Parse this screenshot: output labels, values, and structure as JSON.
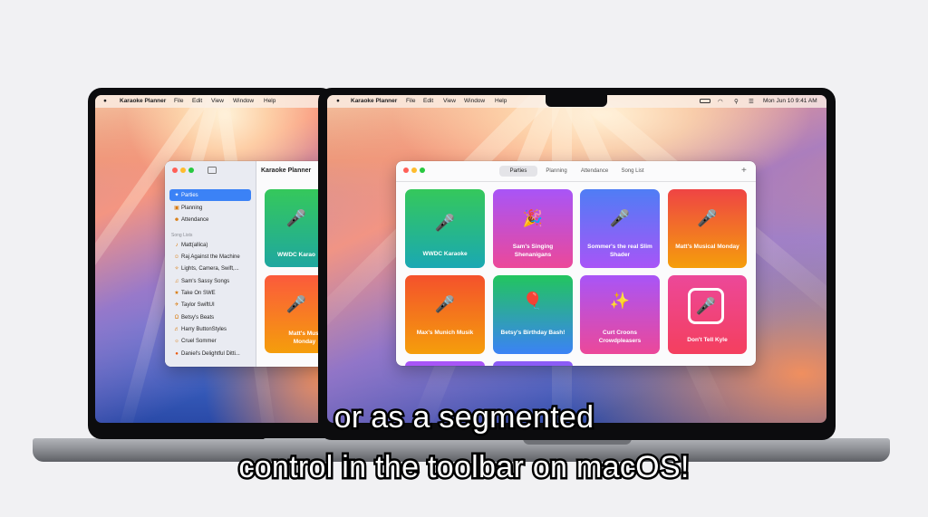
{
  "menubar": {
    "app_name": "Karaoke Planner",
    "items": [
      "File",
      "Edit",
      "View",
      "Window",
      "Help"
    ],
    "clock": "Mon Jun 10  9:41 AM"
  },
  "left_window": {
    "toolbar_title": "Karaoke Planner",
    "sidebar_items": [
      {
        "label": "Parties",
        "icon": "party-popper-icon",
        "selected": true
      },
      {
        "label": "Planning",
        "icon": "calendar-icon",
        "selected": false
      },
      {
        "label": "Attendance",
        "icon": "people-icon",
        "selected": false
      }
    ],
    "section_header": "Song Lists",
    "song_lists": [
      {
        "label": "Matt(allica)",
        "icon": "music-note-icon"
      },
      {
        "label": "Raj Against the Machine",
        "icon": "smiley-icon"
      },
      {
        "label": "Lights, Camera, Swift,...",
        "icon": "sparkle-icon"
      },
      {
        "label": "Sam's Sassy Songs",
        "icon": "music-notes-icon"
      },
      {
        "label": "Take On SWE",
        "icon": "star-icon"
      },
      {
        "label": "Taylor SwiftUI",
        "icon": "bird-icon"
      },
      {
        "label": "Betsy's Beats",
        "icon": "headphones-icon"
      },
      {
        "label": "Harry ButtonStyles",
        "icon": "guitar-icon"
      },
      {
        "label": "Cruel Sommer",
        "icon": "sun-icon"
      },
      {
        "label": "Daniel's Delightful Ditti...",
        "icon": "circle-icon"
      }
    ],
    "tiles": [
      {
        "title": "WWDC Karao",
        "icon": "microphone-icon"
      },
      {
        "title": "Matt's Musi Monday",
        "icon": "microphone-circle-icon"
      }
    ]
  },
  "right_window": {
    "segments": [
      {
        "label": "Parties",
        "selected": true
      },
      {
        "label": "Planning",
        "selected": false
      },
      {
        "label": "Attendance",
        "selected": false
      },
      {
        "label": "Song List",
        "selected": false
      }
    ],
    "add_label": "+",
    "tiles": [
      {
        "title": "WWDC Karaoke",
        "icon": "microphone-icon"
      },
      {
        "title": "Sam's Singing Shenanigans",
        "icon": "party-popper-icon"
      },
      {
        "title": "Sommer's the real Slim Shader",
        "icon": "microphone-tilted-icon"
      },
      {
        "title": "Matt's Musical Monday",
        "icon": "microphone-circle-icon"
      },
      {
        "title": "Max's Munich Musik",
        "icon": "microphone-slash-icon"
      },
      {
        "title": "Betsy's Birthday Bash!",
        "icon": "balloons-icon"
      },
      {
        "title": "Curt Croons Crowdpleasers",
        "icon": "sparkles-icon"
      },
      {
        "title": "Don't Tell Kyle",
        "icon": "microphone-square-icon"
      }
    ]
  },
  "caption": {
    "line1": "or as a segmented",
    "line2": "control in the toolbar on macOS!"
  },
  "colors": {
    "tile_green": "#33c75a",
    "tile_purple": "#a855f7",
    "tile_blue": "#3b82f6",
    "tile_orange": "#f97316",
    "tile_pink": "#ec4899",
    "sidebar_selection": "#3b82f6"
  }
}
